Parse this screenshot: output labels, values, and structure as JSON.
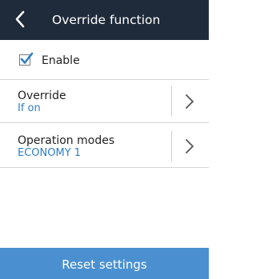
{
  "header": {
    "title": "Override function",
    "back_icon": "chevron-left-icon"
  },
  "enable": {
    "label": "Enable",
    "checked": true
  },
  "rows": [
    {
      "title": "Override",
      "value": "If on",
      "icon": "chevron-right-icon"
    },
    {
      "title": "Operation modes",
      "value": "ECONOMY 1",
      "icon": "chevron-right-icon"
    }
  ],
  "footer": {
    "label": "Reset settings"
  },
  "colors": {
    "header_bg": "#1f2b3a",
    "accent": "#2f7fc3",
    "footer_bg": "#4a90d0"
  }
}
